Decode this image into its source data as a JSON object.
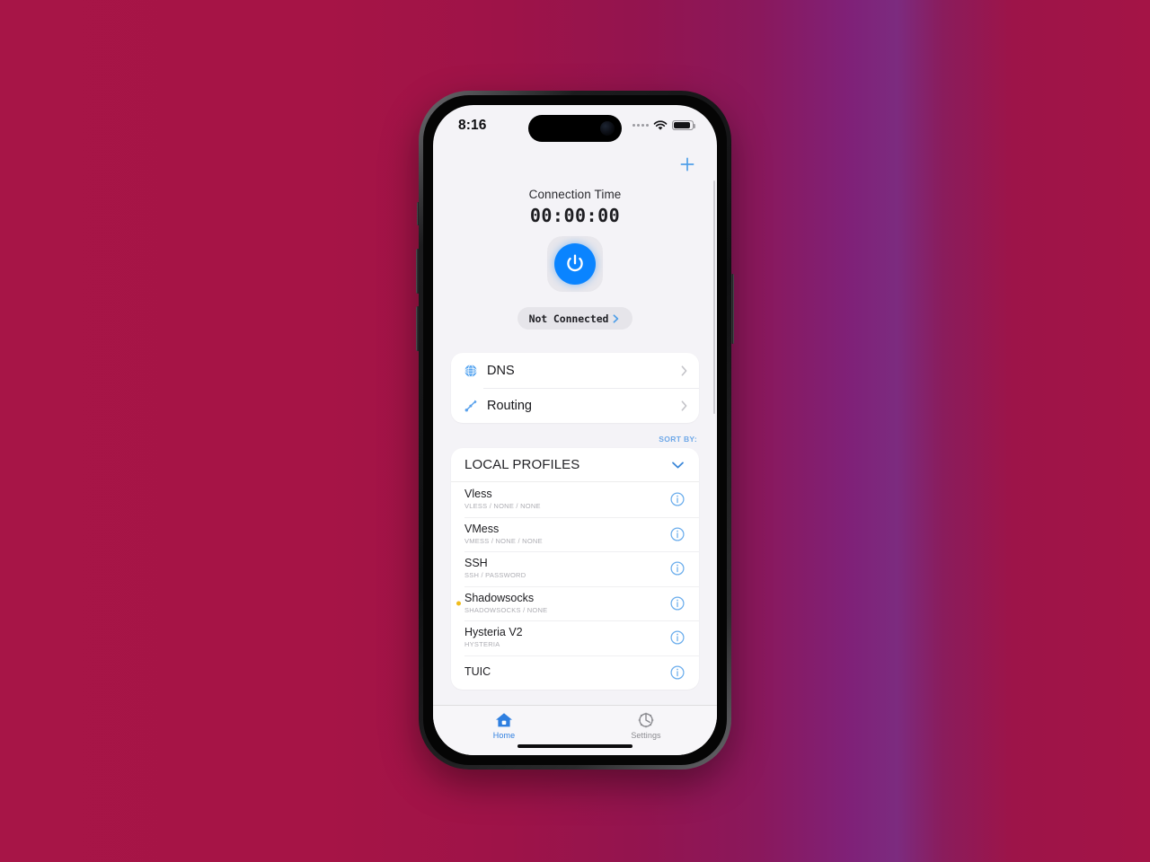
{
  "background": {
    "primary_color": "#a01345",
    "accent_color": "#7c2b7f"
  },
  "device": {
    "status_bar": {
      "time": "8:16",
      "signal_icon": "cellular-signal-icon",
      "wifi_icon": "wifi-icon",
      "battery_icon": "battery-icon"
    },
    "home_indicator": "home-indicator"
  },
  "nav": {
    "add_icon": "plus-icon",
    "add_label": "+"
  },
  "hero": {
    "connection_label": "Connection Time",
    "timer": "00:00:00",
    "power_icon": "power-icon",
    "status_text": "Not Connected",
    "status_chevron": "chevron-right-icon",
    "accent_blue": "#0a84ff"
  },
  "menu": {
    "items": [
      {
        "label": "DNS",
        "icon": "globe-icon",
        "chevron": "chevron-right-icon"
      },
      {
        "label": "Routing",
        "icon": "routing-branch-icon",
        "chevron": "chevron-right-icon"
      }
    ]
  },
  "profiles": {
    "sort_by_label": "SORT BY:",
    "section_title": "LOCAL PROFILES",
    "collapse_icon": "chevron-down-icon",
    "active_dot_color": "#f0bc1c",
    "items": [
      {
        "name": "Vless",
        "subtitle": "VLESS / NONE / NONE",
        "active": false,
        "info_icon": "info-circle-icon"
      },
      {
        "name": "VMess",
        "subtitle": "VMESS / NONE / NONE",
        "active": false,
        "info_icon": "info-circle-icon"
      },
      {
        "name": "SSH",
        "subtitle": "SSH / PASSWORD",
        "active": false,
        "info_icon": "info-circle-icon"
      },
      {
        "name": "Shadowsocks",
        "subtitle": "SHADOWSOCKS / NONE",
        "active": true,
        "info_icon": "info-circle-icon"
      },
      {
        "name": "Hysteria V2",
        "subtitle": "HYSTERIA",
        "active": false,
        "info_icon": "info-circle-icon"
      },
      {
        "name": "TUIC",
        "subtitle": "",
        "active": false,
        "info_icon": "info-circle-icon"
      }
    ]
  },
  "tabbar": {
    "tabs": [
      {
        "label": "Home",
        "icon": "house-icon",
        "active": true
      },
      {
        "label": "Settings",
        "icon": "gear-icon",
        "active": false
      }
    ],
    "active_color": "#2f7fe0",
    "inactive_color": "#8b8b90"
  }
}
